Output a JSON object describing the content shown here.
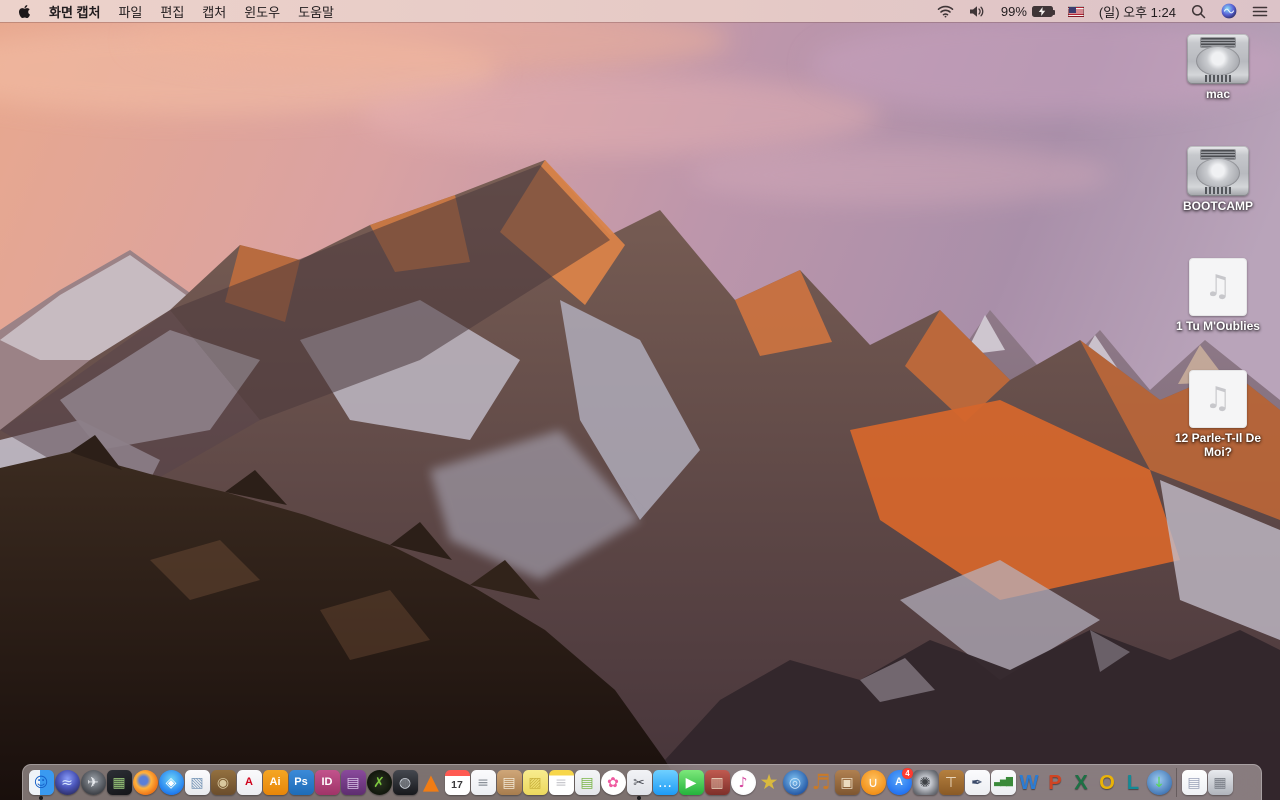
{
  "menu_bar": {
    "app_name": "화면 캡처",
    "menus": [
      "파일",
      "편집",
      "캡처",
      "윈도우",
      "도움말"
    ],
    "status": {
      "battery_percent": "99%",
      "clock": "(일) 오후 1:24",
      "icons": [
        "wifi-icon",
        "volume-icon",
        "battery-charging-icon",
        "us-flag-icon",
        "spotlight-search-icon",
        "siri-icon",
        "notification-center-icon"
      ]
    }
  },
  "desktop": {
    "audio_note_glyph": "♫",
    "icons": [
      {
        "kind": "drive",
        "label": "mac"
      },
      {
        "kind": "drive",
        "label": "BOOTCAMP"
      },
      {
        "kind": "audio",
        "label": "1 Tu M'Oublies"
      },
      {
        "kind": "audio",
        "label": "12 Parle-T-Il De Moi?"
      }
    ]
  },
  "dock": {
    "items": [
      {
        "name": "finder",
        "label": "Finder",
        "shape": "square",
        "bg": "linear-gradient(90deg,#eef3f8 0 45%,#3a9af0 45% 100%)",
        "glyph": "☺",
        "fg": "#1560c8",
        "running": true
      },
      {
        "name": "siri",
        "label": "Siri",
        "shape": "circle",
        "bg": "radial-gradient(circle at 50% 35%,#8a9cf8 0%,#4a55b8 45%,#1e1b3e 100%)",
        "glyph": "≈",
        "fg": "#d8e8ff"
      },
      {
        "name": "launchpad",
        "label": "Launchpad",
        "shape": "circle",
        "bg": "radial-gradient(circle at 50% 40%,#9aa0a8,#43464c 70%,#2a2c30)",
        "glyph": "✈",
        "fg": "#e8eaee"
      },
      {
        "name": "mission-control",
        "label": "Mission Control",
        "shape": "square",
        "bg": "linear-gradient(160deg,#2c2f35,#141519)",
        "glyph": "▦",
        "fg": "#9ac97a"
      },
      {
        "name": "firefox",
        "label": "Firefox",
        "shape": "circle",
        "bg": "radial-gradient(circle at 42% 42%,#5a7fd8 0 20%,#ffb23e 38%,#f07a1a 68%,#d85a10)",
        "glyph": "",
        "fg": "#ffffff"
      },
      {
        "name": "safari",
        "label": "Safari",
        "shape": "circle",
        "bg": "radial-gradient(circle at 50% 38%,#6fd4f8,#1d78ee 75%)",
        "glyph": "◈",
        "fg": "#ffffff"
      },
      {
        "name": "preview",
        "label": "Preview",
        "shape": "square",
        "bg": "linear-gradient(#fbfbfd,#e8eaee)",
        "glyph": "▧",
        "fg": "#7a98b8"
      },
      {
        "name": "journal",
        "label": "Leather journal app",
        "shape": "square",
        "bg": "linear-gradient(#93703f,#6b4d2c)",
        "glyph": "◉",
        "fg": "#d9c89e"
      },
      {
        "name": "acrobat",
        "label": "Adobe Acrobat",
        "shape": "square",
        "bg": "linear-gradient(#fafafc,#ececf0)",
        "glyph": "A",
        "fg": "#d0021b",
        "style": "letter"
      },
      {
        "name": "illustrator",
        "label": "Adobe Illustrator",
        "shape": "square",
        "bg": "linear-gradient(#f5a623,#e8860a)",
        "glyph": "Ai",
        "fg": "#ffffff",
        "style": "letter"
      },
      {
        "name": "photoshop",
        "label": "Adobe Photoshop",
        "shape": "square",
        "bg": "linear-gradient(#3b8ad8,#1e6cb8)",
        "glyph": "Ps",
        "fg": "#ffffff",
        "style": "letter"
      },
      {
        "name": "indesign",
        "label": "Adobe InDesign",
        "shape": "square",
        "bg": "linear-gradient(#c2538c,#a03468)",
        "glyph": "ID",
        "fg": "#ffffff",
        "style": "letter"
      },
      {
        "name": "toast",
        "label": "Toast disc burner",
        "shape": "square",
        "bg": "linear-gradient(#8a4a9c,#5e2d70)",
        "glyph": "▤",
        "fg": "#d9c2e8"
      },
      {
        "name": "green-x-app",
        "label": "Green X utility",
        "shape": "circle",
        "bg": "radial-gradient(circle,#2a3420,#0e120a 80%)",
        "glyph": "✗",
        "fg": "#7dc93f"
      },
      {
        "name": "disk-tool",
        "label": "Disk utility app",
        "shape": "square",
        "bg": "linear-gradient(#45484f,#17181c)",
        "glyph": "◍",
        "fg": "#cfd4dc"
      },
      {
        "name": "vlc",
        "label": "VLC",
        "shape": "none",
        "bg": "",
        "glyph": "▲",
        "fg": "#f07c14",
        "style": "big"
      },
      {
        "name": "calendar",
        "label": "Calendar",
        "shape": "square",
        "bg": "linear-gradient(#ff5a52 0 23%,#ffffff 23%)",
        "glyph": "17",
        "fg": "#3a3a3c",
        "style": "cal"
      },
      {
        "name": "reminders",
        "label": "Reminders",
        "shape": "square",
        "bg": "linear-gradient(#fbfbfd,#eceef2)",
        "glyph": "≡",
        "fg": "#8a9098"
      },
      {
        "name": "unarchiver",
        "label": "Archive box utility",
        "shape": "square",
        "bg": "linear-gradient(#cfa678,#a87d4e)",
        "glyph": "▤",
        "fg": "#f2e8d4"
      },
      {
        "name": "stickies",
        "label": "Stickies",
        "shape": "square",
        "bg": "linear-gradient(#f8ec8e,#ecd85e)",
        "glyph": "▨",
        "fg": "#c9b23e"
      },
      {
        "name": "notes",
        "label": "Notes",
        "shape": "square",
        "bg": "linear-gradient(#f7d64a 0 22%,#ffffff 22%)",
        "glyph": "≡",
        "fg": "#c9c9ce"
      },
      {
        "name": "documents-app",
        "label": "Documents app",
        "shape": "square",
        "bg": "linear-gradient(#f4f5f7,#e4e6ea)",
        "glyph": "▤",
        "fg": "#7ab648"
      },
      {
        "name": "photos",
        "label": "Photos",
        "shape": "circle",
        "bg": "#ffffff",
        "glyph": "✿",
        "fg": "#ef5aa0"
      },
      {
        "name": "grab",
        "label": "화면 캡처 (Grab)",
        "shape": "square",
        "bg": "linear-gradient(#f2f3f6,#dfe2e8)",
        "glyph": "✂",
        "fg": "#4a4d55",
        "running": true
      },
      {
        "name": "messages",
        "label": "Messages",
        "shape": "square",
        "bg": "linear-gradient(#6fd0ff,#1e9bf5)",
        "glyph": "…",
        "fg": "#ffffff"
      },
      {
        "name": "facetime",
        "label": "FaceTime",
        "shape": "square",
        "bg": "linear-gradient(#7ce87a,#24b33c)",
        "glyph": "▶",
        "fg": "#ffffff"
      },
      {
        "name": "photo-booth",
        "label": "Photo Booth",
        "shape": "square",
        "bg": "linear-gradient(#c05a50,#7e2f2a)",
        "glyph": "▥",
        "fg": "#ecd9c2"
      },
      {
        "name": "itunes",
        "label": "iTunes",
        "shape": "circle",
        "bg": "radial-gradient(circle,#ffffff 55%,#f0f0f4)",
        "glyph": "♪",
        "fg": "#d6469e"
      },
      {
        "name": "imovie",
        "label": "iMovie",
        "shape": "none",
        "bg": "",
        "glyph": "★",
        "fg": "#d9b93e",
        "style": "big"
      },
      {
        "name": "idvd",
        "label": "iDVD",
        "shape": "circle",
        "bg": "radial-gradient(circle at 45% 40%,#7ec2f2,#1d4f9e 80%)",
        "glyph": "◎",
        "fg": "#cfe6fa"
      },
      {
        "name": "garageband",
        "label": "GarageBand",
        "shape": "none",
        "bg": "",
        "glyph": "♬",
        "fg": "#c97a28",
        "style": "big"
      },
      {
        "name": "scrapbook",
        "label": "Corkboard scrapbook app",
        "shape": "square",
        "bg": "linear-gradient(#b08050,#7e5630)",
        "glyph": "▣",
        "fg": "#ecdcc0"
      },
      {
        "name": "ibooks",
        "label": "iBooks",
        "shape": "circle",
        "bg": "radial-gradient(circle at 50% 38%,#ffc05e,#f08c12 80%)",
        "glyph": "∪",
        "fg": "#ffffff"
      },
      {
        "name": "app-store",
        "label": "App Store",
        "shape": "circle",
        "bg": "radial-gradient(circle at 50% 38%,#5aa8f8,#1e6ef0 80%)",
        "glyph": "A",
        "fg": "#ffffff",
        "style": "letter",
        "badge": "4"
      },
      {
        "name": "system-preferences",
        "label": "System Preferences",
        "shape": "square",
        "bg": "radial-gradient(circle,#c8cbd2 30%,#6e7178 75%,#4a4d52)",
        "glyph": "✺",
        "fg": "#3f4247"
      },
      {
        "name": "keynote",
        "label": "Keynote",
        "shape": "square",
        "bg": "linear-gradient(#b5803f,#8a5a26)",
        "glyph": "⊤",
        "fg": "#f0e0c8"
      },
      {
        "name": "pages-09",
        "label": "Pages '09",
        "shape": "square",
        "bg": "linear-gradient(#fbfbfd,#eceef2)",
        "glyph": "✒",
        "fg": "#3a4a6a"
      },
      {
        "name": "numbers-09",
        "label": "Numbers '09",
        "shape": "square",
        "bg": "linear-gradient(#fbfbfd,#eceef2)",
        "glyph": "▃▅▇",
        "fg": "#3a8a3a",
        "style": "bars"
      },
      {
        "name": "word",
        "label": "Microsoft Word",
        "shape": "none",
        "bg": "",
        "glyph": "W",
        "fg": "#2b7cd3",
        "style": "office"
      },
      {
        "name": "powerpoint",
        "label": "Microsoft PowerPoint",
        "shape": "none",
        "bg": "",
        "glyph": "P",
        "fg": "#d04423",
        "style": "office"
      },
      {
        "name": "excel",
        "label": "Microsoft Excel",
        "shape": "none",
        "bg": "",
        "glyph": "X",
        "fg": "#1e7145",
        "style": "office"
      },
      {
        "name": "outlook",
        "label": "Microsoft Outlook",
        "shape": "none",
        "bg": "",
        "glyph": "O",
        "fg": "#eab308",
        "style": "office"
      },
      {
        "name": "lync",
        "label": "Microsoft Lync",
        "shape": "none",
        "bg": "",
        "glyph": "L",
        "fg": "#148a96",
        "style": "office"
      },
      {
        "name": "download-manager",
        "label": "Download manager",
        "shape": "circle",
        "bg": "radial-gradient(circle at 45% 40%,#9ecbf0,#3a6fb0 80%)",
        "glyph": "↓",
        "fg": "#58d858"
      },
      {
        "divider": true
      },
      {
        "name": "downloads-doc",
        "label": "Downloads document",
        "shape": "square",
        "bg": "linear-gradient(#ffffff,#eef0f4)",
        "glyph": "▤",
        "fg": "#9aa2b8"
      },
      {
        "name": "trash",
        "label": "Trash (full)",
        "shape": "square",
        "bg": "linear-gradient(#e8eaee,#b0b4bc)",
        "glyph": "▦",
        "fg": "#787c85"
      }
    ]
  },
  "wallpaper": {
    "name": "sierra-mountain-sunrise",
    "colors": {
      "sky_left": "#e8a88e",
      "sky_right": "#a98fa9",
      "sunlit_rock": "#d4662c",
      "snow": "#c7c0ca",
      "foreground_rock": "#1c1410",
      "menubar_tint": "#e8cec9",
      "dock_tint": "#d6cccc"
    }
  }
}
